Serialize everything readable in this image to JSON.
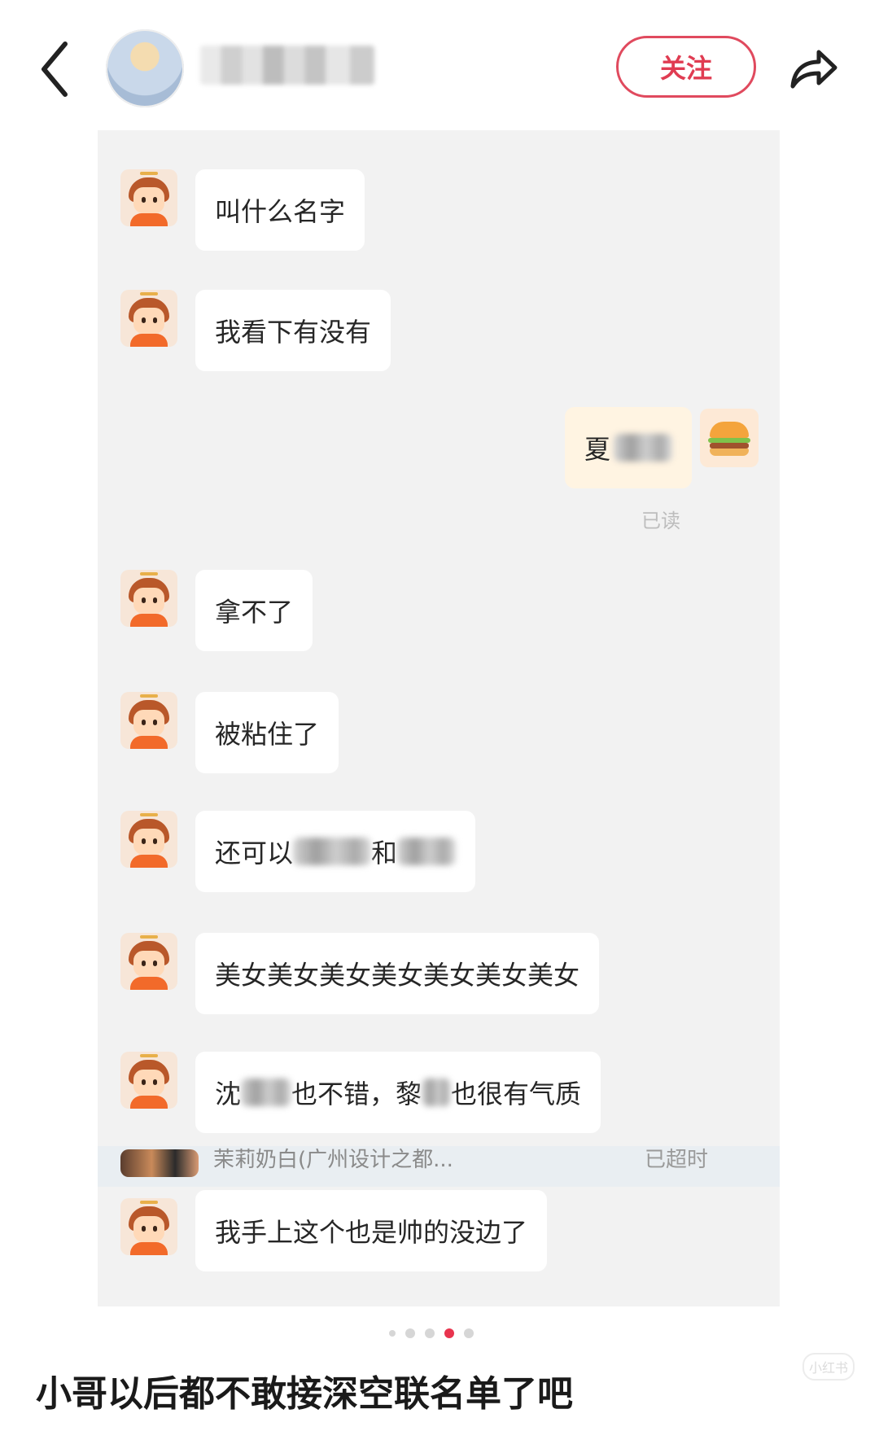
{
  "header": {
    "follow_label": "关注",
    "icons": {
      "back": "back-chevron-icon",
      "share": "share-arrow-icon"
    }
  },
  "messages": [
    {
      "side": "left",
      "text": "叫什么名字"
    },
    {
      "side": "left",
      "text": "我看下有没有"
    },
    {
      "side": "right",
      "text": "夏",
      "read_status": "已读"
    },
    {
      "side": "left",
      "text": "拿不了"
    },
    {
      "side": "left",
      "text": "被粘住了"
    },
    {
      "side": "left",
      "parts": [
        "还可以",
        "和"
      ]
    },
    {
      "side": "left",
      "text": "美女美女美女美女美女美女美女"
    },
    {
      "side": "left",
      "parts": [
        "沈",
        "也不错，黎",
        "也很有气质"
      ]
    },
    {
      "side": "left",
      "text": "我手上这个也是帅的没边了"
    }
  ],
  "order_strip": {
    "text": "茉莉奶白(广州设计之都...",
    "status": "已超时"
  },
  "carousel": {
    "count": 5,
    "active_index": 3
  },
  "caption": "小哥以后都不敢接深空联名单了吧",
  "watermark": "小红书",
  "colors": {
    "accent": "#e8344e",
    "panel_bg": "#f2f2f2",
    "bubble_self": "#fff4e2"
  }
}
